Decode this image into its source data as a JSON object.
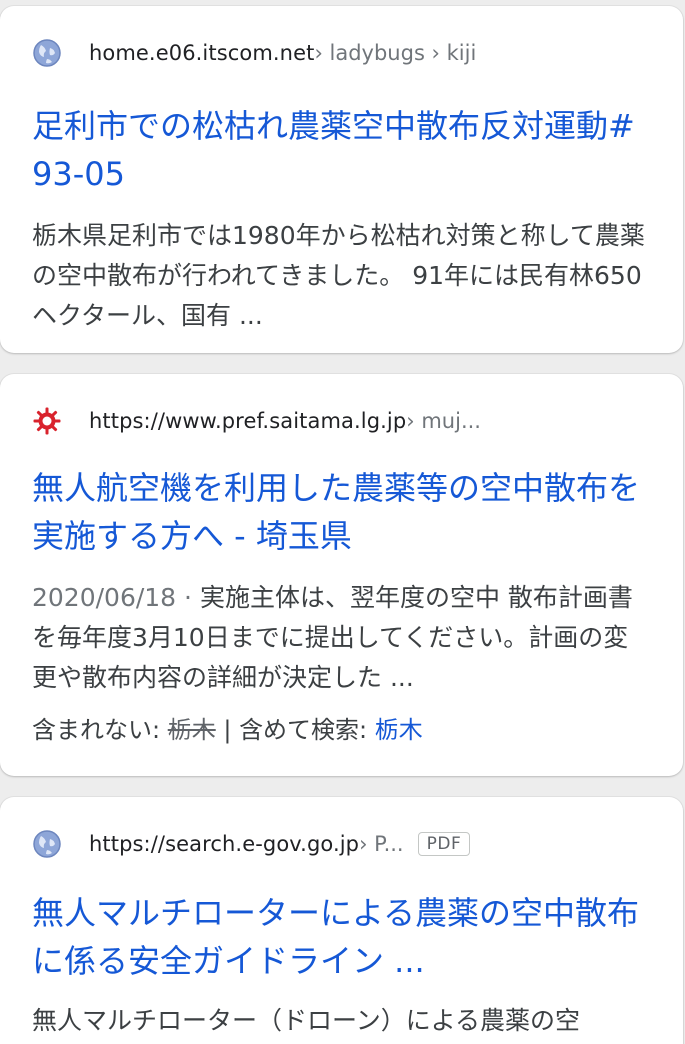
{
  "results": [
    {
      "favicon": "globe-icon",
      "host": "home.e06.itscom.net",
      "path": " › ladybugs › kiji",
      "title": "足利市での松枯れ農薬空中散布反対運動#93-05",
      "snippet": "栃木県足利市では1980年から松枯れ対策と称して農薬の空中散布が行われてきました。 91年には民有林650ヘクタール、国有 ..."
    },
    {
      "favicon": "saitama-emblem-icon",
      "host": "https://www.pref.saitama.lg.jp",
      "path": " › muj...",
      "title": "無人航空機を利用した農薬等の空中散布を実施する方へ - 埼玉県",
      "date": "2020/06/18 · ",
      "snippet": "実施主体は、翌年度の空中 散布計画書を毎年度3月10日までに提出してください。計画の変更や散布内容の詳細が決定した ...",
      "missing_label": "含まれない: ",
      "missing_term": "栃木",
      "search_with_label": " | 含めて検索: ",
      "search_with_term": "栃木"
    },
    {
      "favicon": "globe-icon",
      "host": "https://search.e-gov.go.jp",
      "path": " › P...",
      "badge": "PDF",
      "title": "無人マルチローターによる農薬の空中散布に係る安全ガイドライン ...",
      "snippet": "無人マルチローター（ドローン）による農薬の空"
    }
  ],
  "colors": {
    "link": "#1558d6",
    "url_path": "#70757a",
    "snippet": "#3c4043",
    "background": "#ededed"
  }
}
